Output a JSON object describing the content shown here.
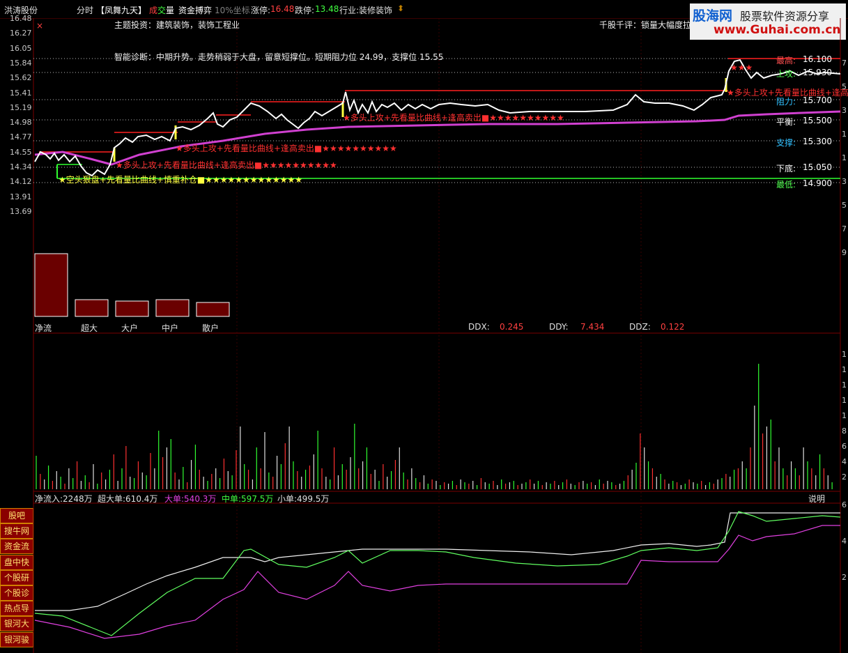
{
  "header": {
    "stock": "洪涛股份",
    "mode": "分时",
    "indicator": "【凤舞九天】",
    "cheng": "成",
    "jiao": "交",
    "liang": "量",
    "fund_game": "资金搏弈",
    "coord": "10%坐标",
    "limit_up_label": "涨停:",
    "limit_up": "16.48",
    "limit_down_label": "跌停:",
    "limit_down": "13.48",
    "industry": "行业:装修装饰",
    "arrow": "⬍"
  },
  "logo": {
    "brand": "股海网",
    "slogan": "股票软件资源分享",
    "url": "www.Guhai.com.cn"
  },
  "info": {
    "theme": "主题投资：建筑装饰，装饰工程业",
    "comment": "千股千评：锁量大幅度拉",
    "diagnosis": "智能诊断：中期升势。走势稍弱于大盘，留意短撑位。短期阻力位 24.99，支撑位 15.55"
  },
  "price_axis": [
    "16.48",
    "16.27",
    "16.05",
    "15.84",
    "15.62",
    "15.41",
    "15.19",
    "14.98",
    "14.77",
    "14.55",
    "14.34",
    "14.12",
    "13.91",
    "13.69"
  ],
  "right_axis": [
    "7",
    "5",
    "3",
    "1",
    "1",
    "3",
    "5",
    "7",
    "9"
  ],
  "levels": [
    {
      "name": "最高:",
      "value": "16.100",
      "color": "#ff5050"
    },
    {
      "name": "上攻:",
      "value": "15.930",
      "color": "#50ff50"
    },
    {
      "name": "阻力:",
      "value": "15.700",
      "color": "#30c0ff"
    },
    {
      "name": "平衡:",
      "value": "15.500",
      "color": "#ffffff"
    },
    {
      "name": "支撑:",
      "value": "15.300",
      "color": "#30c0ff"
    },
    {
      "name": "下底:",
      "value": "15.050",
      "color": "#ffffff"
    },
    {
      "name": "最低:",
      "value": "14.900",
      "color": "#50ff50"
    }
  ],
  "signals": [
    "★多头上攻+先看量比曲线+逢高卖出■★★★★★★★★★★",
    "★多头上攻+先看量比曲线+逢高卖出■★★★★★★★★★★",
    "★多头上攻+先看量比曲线+逢高卖出■★★★★★★★★★★",
    "★空头狠盘+先看量比曲线+慎重补仓■★★★★★★★★★★★★★",
    "★多头上攻+先看量比曲线+逢高",
    "★★★"
  ],
  "fund_bars": {
    "labels": [
      "净流",
      "超大",
      "大户",
      "中户",
      "散户"
    ],
    "values": [
      90,
      24,
      22,
      24,
      20
    ]
  },
  "ddx": {
    "ddx_label": "DDX:",
    "ddx": "0.245",
    "ddy_label": "DDY:",
    "ddy": "7.434",
    "ddz_label": "DDZ:",
    "ddz": "0.122"
  },
  "vol_axis": [
    "1",
    "1",
    "1",
    "1",
    "1",
    "8",
    "6",
    "4",
    "2"
  ],
  "flow": {
    "net": "净流入:2248万",
    "super": "超大单:610.4万",
    "big": "大单:540.3万",
    "mid": "中单:597.5万",
    "small": "小单:499.5万",
    "explain": "说明"
  },
  "bottom_axis": [
    "6",
    "4",
    "2"
  ],
  "sidebar": [
    "股吧",
    "搜牛网",
    "资金流向",
    "盘中快讯",
    "个股研报",
    "个股诊断",
    "热点导航",
    "银河大势",
    "银河骏马"
  ],
  "close_mark": "×",
  "colors": {
    "up": "#ff3030",
    "down": "#30ff30",
    "price": "#ffffff",
    "avg": "#d040d0",
    "bar_fill": "#6a0000"
  }
}
